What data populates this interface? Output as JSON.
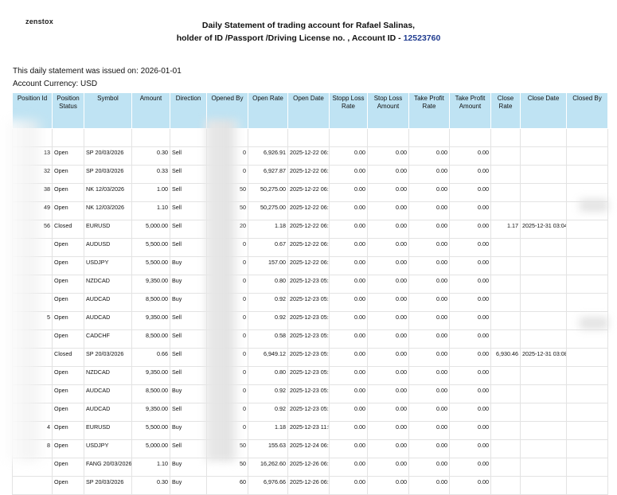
{
  "logo": "zenstox",
  "header": {
    "line1": "Daily Statement of trading account for Rafael Salinas,",
    "line2_prefix": "holder of ID /Passport /Driving License no. , Account ID - ",
    "account_id": "12523760"
  },
  "issued": "This daily statement was issued on: 2026-01-01",
  "currency": "Account Currency: USD",
  "columns": [
    "Position Id",
    "Position Status",
    "Symbol",
    "Amount",
    "Direction",
    "Opened By",
    "Open Rate",
    "Open Date",
    "Stopp Loss Rate",
    "Stop Loss Amount",
    "Take Profit Rate",
    "Take Profit Amount",
    "Close Rate",
    "Close Date",
    "Closed By"
  ],
  "rows": [
    {
      "id": "13",
      "status": "Open",
      "symbol": "SP 20/03/2026",
      "amount": "0.30",
      "direction": "Sell",
      "opened_by": "0",
      "open_rate": "6,926.91",
      "open_date": "2025-12-22 06:18:11",
      "sl_rate": "0.00",
      "sl_amount": "0.00",
      "tp_rate": "0.00",
      "tp_amount": "0.00",
      "close_rate": "",
      "close_date": "",
      "closed_by": ""
    },
    {
      "id": "32",
      "status": "Open",
      "symbol": "SP 20/03/2026",
      "amount": "0.33",
      "direction": "Sell",
      "opened_by": "0",
      "open_rate": "6,927.87",
      "open_date": "2025-12-22 06:19:41",
      "sl_rate": "0.00",
      "sl_amount": "0.00",
      "tp_rate": "0.00",
      "tp_amount": "0.00",
      "close_rate": "",
      "close_date": "",
      "closed_by": ""
    },
    {
      "id": "38",
      "status": "Open",
      "symbol": "NK 12/03/2026",
      "amount": "1.00",
      "direction": "Sell",
      "opened_by": "50",
      "open_rate": "50,275.00",
      "open_date": "2025-12-22 06:20:23",
      "sl_rate": "0.00",
      "sl_amount": "0.00",
      "tp_rate": "0.00",
      "tp_amount": "0.00",
      "close_rate": "",
      "close_date": "",
      "closed_by": ""
    },
    {
      "id": "49",
      "status": "Open",
      "symbol": "NK 12/03/2026",
      "amount": "1.10",
      "direction": "Sell",
      "opened_by": "50",
      "open_rate": "50,275.00",
      "open_date": "2025-12-22 06:21:12",
      "sl_rate": "0.00",
      "sl_amount": "0.00",
      "tp_rate": "0.00",
      "tp_amount": "0.00",
      "close_rate": "",
      "close_date": "",
      "closed_by": ""
    },
    {
      "id": "56",
      "status": "Closed",
      "symbol": "EURUSD",
      "amount": "5,000.00",
      "direction": "Sell",
      "opened_by": "20",
      "open_rate": "1.18",
      "open_date": "2025-12-22 06:22:09",
      "sl_rate": "0.00",
      "sl_amount": "0.00",
      "tp_rate": "0.00",
      "tp_amount": "0.00",
      "close_rate": "1.17",
      "close_date": "2025-12-31 03:04:22",
      "closed_by": ""
    },
    {
      "id": "",
      "status": "Open",
      "symbol": "AUDUSD",
      "amount": "5,500.00",
      "direction": "Sell",
      "opened_by": "0",
      "open_rate": "0.67",
      "open_date": "2025-12-22 06:25:16",
      "sl_rate": "0.00",
      "sl_amount": "0.00",
      "tp_rate": "0.00",
      "tp_amount": "0.00",
      "close_rate": "",
      "close_date": "",
      "closed_by": ""
    },
    {
      "id": "",
      "status": "Open",
      "symbol": "USDJPY",
      "amount": "5,500.00",
      "direction": "Buy",
      "opened_by": "0",
      "open_rate": "157.00",
      "open_date": "2025-12-22 06:28:10",
      "sl_rate": "0.00",
      "sl_amount": "0.00",
      "tp_rate": "0.00",
      "tp_amount": "0.00",
      "close_rate": "",
      "close_date": "",
      "closed_by": ""
    },
    {
      "id": "",
      "status": "Open",
      "symbol": "NZDCAD",
      "amount": "9,350.00",
      "direction": "Buy",
      "opened_by": "0",
      "open_rate": "0.80",
      "open_date": "2025-12-23 05:47:24",
      "sl_rate": "0.00",
      "sl_amount": "0.00",
      "tp_rate": "0.00",
      "tp_amount": "0.00",
      "close_rate": "",
      "close_date": "",
      "closed_by": ""
    },
    {
      "id": "",
      "status": "Open",
      "symbol": "AUDCAD",
      "amount": "8,500.00",
      "direction": "Buy",
      "opened_by": "0",
      "open_rate": "0.92",
      "open_date": "2025-12-23 05:47:52",
      "sl_rate": "0.00",
      "sl_amount": "0.00",
      "tp_rate": "0.00",
      "tp_amount": "0.00",
      "close_rate": "",
      "close_date": "",
      "closed_by": ""
    },
    {
      "id": "5",
      "status": "Open",
      "symbol": "AUDCAD",
      "amount": "9,350.00",
      "direction": "Sell",
      "opened_by": "0",
      "open_rate": "0.92",
      "open_date": "2025-12-23 05:48:42",
      "sl_rate": "0.00",
      "sl_amount": "0.00",
      "tp_rate": "0.00",
      "tp_amount": "0.00",
      "close_rate": "",
      "close_date": "",
      "closed_by": ""
    },
    {
      "id": "",
      "status": "Open",
      "symbol": "CADCHF",
      "amount": "8,500.00",
      "direction": "Sell",
      "opened_by": "0",
      "open_rate": "0.58",
      "open_date": "2025-12-23 05:49:18",
      "sl_rate": "0.00",
      "sl_amount": "0.00",
      "tp_rate": "0.00",
      "tp_amount": "0.00",
      "close_rate": "",
      "close_date": "",
      "closed_by": ""
    },
    {
      "id": "",
      "status": "Closed",
      "symbol": "SP 20/03/2026",
      "amount": "0.66",
      "direction": "Sell",
      "opened_by": "0",
      "open_rate": "6,949.12",
      "open_date": "2025-12-23 05:55:03",
      "sl_rate": "0.00",
      "sl_amount": "0.00",
      "tp_rate": "0.00",
      "tp_amount": "0.00",
      "close_rate": "6,930.46",
      "close_date": "2025-12-31 03:08:00",
      "closed_by": ""
    },
    {
      "id": "",
      "status": "Open",
      "symbol": "NZDCAD",
      "amount": "9,350.00",
      "direction": "Sell",
      "opened_by": "0",
      "open_rate": "0.80",
      "open_date": "2025-12-23 05:56:20",
      "sl_rate": "0.00",
      "sl_amount": "0.00",
      "tp_rate": "0.00",
      "tp_amount": "0.00",
      "close_rate": "",
      "close_date": "",
      "closed_by": ""
    },
    {
      "id": "",
      "status": "Open",
      "symbol": "AUDCAD",
      "amount": "8,500.00",
      "direction": "Buy",
      "opened_by": "0",
      "open_rate": "0.92",
      "open_date": "2025-12-23 05:56:50",
      "sl_rate": "0.00",
      "sl_amount": "0.00",
      "tp_rate": "0.00",
      "tp_amount": "0.00",
      "close_rate": "",
      "close_date": "",
      "closed_by": ""
    },
    {
      "id": "",
      "status": "Open",
      "symbol": "AUDCAD",
      "amount": "9,350.00",
      "direction": "Sell",
      "opened_by": "0",
      "open_rate": "0.92",
      "open_date": "2025-12-23 05:58:17",
      "sl_rate": "0.00",
      "sl_amount": "0.00",
      "tp_rate": "0.00",
      "tp_amount": "0.00",
      "close_rate": "",
      "close_date": "",
      "closed_by": ""
    },
    {
      "id": "4",
      "status": "Open",
      "symbol": "EURUSD",
      "amount": "5,500.00",
      "direction": "Buy",
      "opened_by": "0",
      "open_rate": "1.18",
      "open_date": "2025-12-23 11:53:55",
      "sl_rate": "0.00",
      "sl_amount": "0.00",
      "tp_rate": "0.00",
      "tp_amount": "0.00",
      "close_rate": "",
      "close_date": "",
      "closed_by": ""
    },
    {
      "id": "8",
      "status": "Open",
      "symbol": "USDJPY",
      "amount": "5,000.00",
      "direction": "Sell",
      "opened_by": "50",
      "open_rate": "155.63",
      "open_date": "2025-12-24 06:14:50",
      "sl_rate": "0.00",
      "sl_amount": "0.00",
      "tp_rate": "0.00",
      "tp_amount": "0.00",
      "close_rate": "",
      "close_date": "",
      "closed_by": ""
    },
    {
      "id": "",
      "status": "Open",
      "symbol": "FANG 20/03/2026",
      "amount": "1.10",
      "direction": "Buy",
      "opened_by": "50",
      "open_rate": "16,262.60",
      "open_date": "2025-12-26 06:09:36",
      "sl_rate": "0.00",
      "sl_amount": "0.00",
      "tp_rate": "0.00",
      "tp_amount": "0.00",
      "close_rate": "",
      "close_date": "",
      "closed_by": ""
    },
    {
      "id": "",
      "status": "Open",
      "symbol": "SP 20/03/2026",
      "amount": "0.30",
      "direction": "Buy",
      "opened_by": "60",
      "open_rate": "6,976.66",
      "open_date": "2025-12-26 06:10:07",
      "sl_rate": "0.00",
      "sl_amount": "0.00",
      "tp_rate": "0.00",
      "tp_amount": "0.00",
      "close_rate": "",
      "close_date": "",
      "closed_by": ""
    }
  ]
}
